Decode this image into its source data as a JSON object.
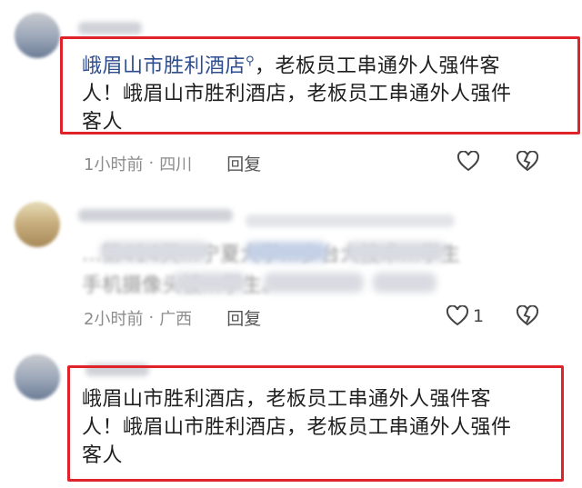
{
  "comments": [
    {
      "linked_place": "峨眉山市胜利酒店",
      "text_rest": "，老板员工串通外人强件客人！峨眉山市胜利酒店，老板员工串通外人强件客人",
      "line1_rest": "，老板员工串通外人强件客",
      "line2": "人！峨眉山市胜利酒店，老板员工串通外人强件",
      "line3": "客人",
      "time": "1小时前",
      "location": "四川",
      "reply_label": "回复",
      "like_count": ""
    },
    {
      "line1": "…第414天…宁夏大学…乡台大技术…学生",
      "line2": "手机摄像头被…学生。",
      "time": "2小时前",
      "location": "广西",
      "reply_label": "回复",
      "like_count": "1"
    },
    {
      "line1": "峨眉山市胜利酒店，老板员工串通外人强件客",
      "line2": "人！峨眉山市胜利酒店，老板员工串通外人强件",
      "line3": "客人"
    }
  ],
  "separator": "·",
  "icons": {
    "like": "heart-outline-icon",
    "dislike": "broken-heart-icon",
    "search": "search-icon"
  },
  "colors": {
    "highlight_border": "#e0222a",
    "link": "#2e4d8f",
    "meta": "#8c8c8c"
  }
}
